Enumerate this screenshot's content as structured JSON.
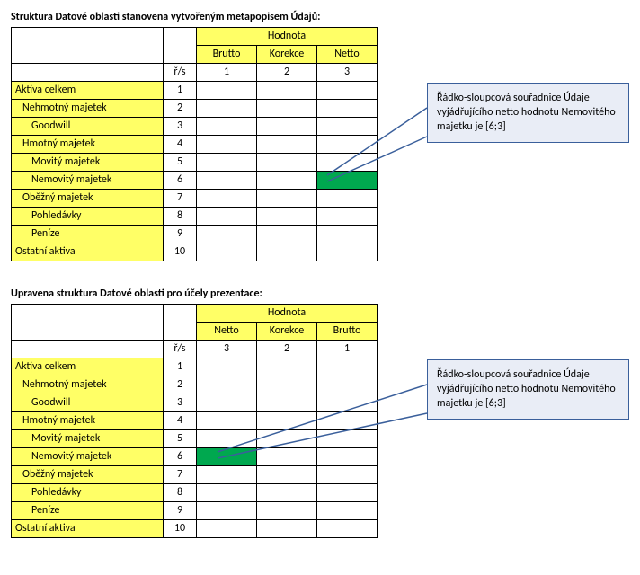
{
  "section1": {
    "title": "Struktura Datové oblasti stanovena vytvořeným metapopisem Údajů:",
    "header_group": "Hodnota",
    "cols": [
      "Brutto",
      "Korekce",
      "Netto"
    ],
    "rs_label": "ř/s",
    "col_nums": [
      "1",
      "2",
      "3"
    ],
    "rows": [
      {
        "n": "1",
        "label": "Aktiva celkem",
        "indent": 0
      },
      {
        "n": "2",
        "label": "Nehmotný majetek",
        "indent": 1
      },
      {
        "n": "3",
        "label": "Goodwill",
        "indent": 2
      },
      {
        "n": "4",
        "label": "Hmotný majetek",
        "indent": 1
      },
      {
        "n": "5",
        "label": "Movitý majetek",
        "indent": 2
      },
      {
        "n": "6",
        "label": "Nemovitý majetek",
        "indent": 2,
        "highlight_col": 2
      },
      {
        "n": "7",
        "label": "Oběžný majetek",
        "indent": 1
      },
      {
        "n": "8",
        "label": "Pohledávky",
        "indent": 2
      },
      {
        "n": "9",
        "label": "Peníze",
        "indent": 2
      },
      {
        "n": "10",
        "label": "Ostatní aktiva",
        "indent": 0
      }
    ],
    "callout": "Řádko-sloupcová souřadnice Údaje vyjádřujícího netto hodnotu Nemovitého majetku je [6;3]"
  },
  "section2": {
    "title": "Upravena struktura Datové oblasti pro účely prezentace:",
    "header_group": "Hodnota",
    "cols": [
      "Netto",
      "Korekce",
      "Brutto"
    ],
    "rs_label": "ř/s",
    "col_nums": [
      "3",
      "2",
      "1"
    ],
    "rows": [
      {
        "n": "1",
        "label": "Aktiva celkem",
        "indent": 0
      },
      {
        "n": "2",
        "label": "Nehmotný majetek",
        "indent": 1
      },
      {
        "n": "3",
        "label": "Goodwill",
        "indent": 2
      },
      {
        "n": "4",
        "label": "Hmotný majetek",
        "indent": 1
      },
      {
        "n": "5",
        "label": "Movitý majetek",
        "indent": 2
      },
      {
        "n": "6",
        "label": "Nemovitý majetek",
        "indent": 2,
        "highlight_col": 0
      },
      {
        "n": "7",
        "label": "Oběžný majetek",
        "indent": 1
      },
      {
        "n": "8",
        "label": "Pohledávky",
        "indent": 2
      },
      {
        "n": "9",
        "label": "Peníze",
        "indent": 2
      },
      {
        "n": "10",
        "label": "Ostatní aktiva",
        "indent": 0
      }
    ],
    "callout": "Řádko-sloupcová souřadnice Údaje vyjádřujícího netto hodnotu Nemovitého majetku je [6;3]"
  }
}
